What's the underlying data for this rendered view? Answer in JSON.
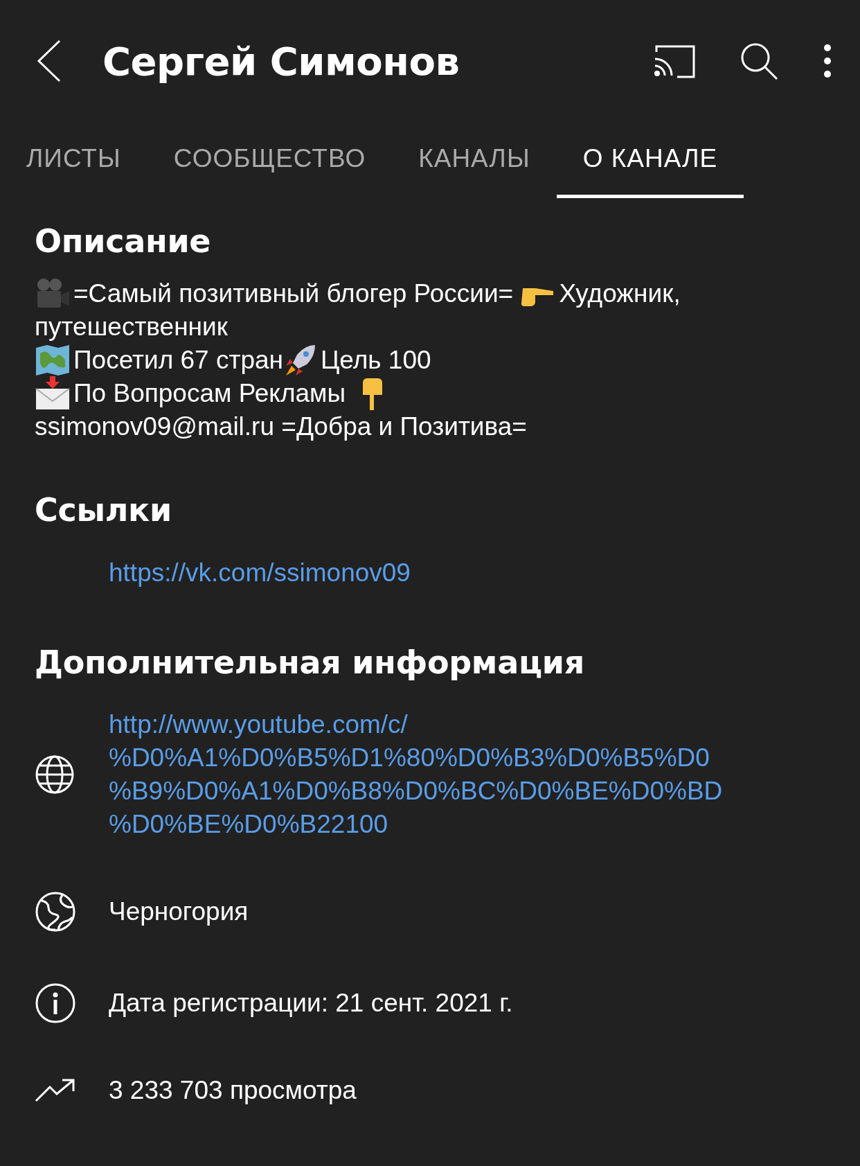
{
  "header": {
    "title": "Сергей Симонов"
  },
  "tabs": [
    {
      "label": "ЛИСТЫ",
      "selected": false
    },
    {
      "label": "СООБЩЕСТВО",
      "selected": false
    },
    {
      "label": "КАНАЛЫ",
      "selected": false
    },
    {
      "label": "О КАНАЛЕ",
      "selected": true
    }
  ],
  "description": {
    "heading": "Описание",
    "lines": [
      [
        {
          "kind": "emoji"
        },
        {
          "kind": "text",
          "text": "=Самый позитивный блогер России= "
        },
        {
          "kind": "emoji"
        },
        {
          "kind": "text",
          "text": "Художник,"
        }
      ],
      [
        {
          "kind": "text",
          "text": "путешественник"
        }
      ],
      [
        {
          "kind": "emoji"
        },
        {
          "kind": "text",
          "text": "Посетил 67 стран"
        },
        {
          "kind": "emoji"
        },
        {
          "kind": "text",
          "text": "Цель 100"
        }
      ],
      [
        {
          "kind": "emoji"
        },
        {
          "kind": "text",
          "text": "По Вопросам Рекламы  "
        },
        {
          "kind": "emoji"
        }
      ],
      [
        {
          "kind": "text",
          "text": "ssimonov09@mail.ru =Добра и Позитива="
        }
      ]
    ]
  },
  "links": {
    "heading": "Ссылки",
    "items": [
      "https://vk.com/ssimonov09"
    ]
  },
  "details": {
    "heading": "Дополнительная информация",
    "items": [
      {
        "kind": "url",
        "lines": [
          "http://www.youtube.com/c/",
          "%D0%A1%D0%B5%D1%80%D0%B3%D0%B5%D0",
          "%B9%D0%A1%D0%B8%D0%BC%D0%BE%D0%BD",
          "%D0%BE%D0%B22100"
        ]
      },
      {
        "kind": "location",
        "lines": [
          "Черногория"
        ]
      },
      {
        "kind": "joined",
        "lines": [
          "Дата регистрации: 21 сент. 2021 г."
        ]
      },
      {
        "kind": "views",
        "lines": [
          "3 233 703 просмотра"
        ]
      }
    ]
  }
}
